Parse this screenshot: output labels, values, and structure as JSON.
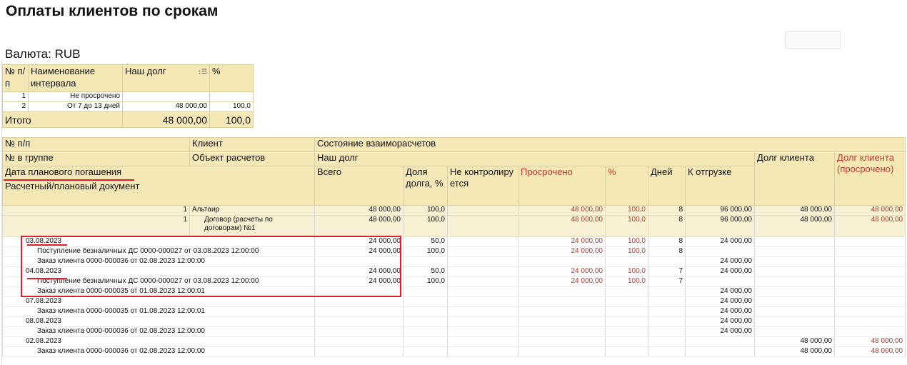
{
  "title": "Оплаты клиентов по срокам",
  "currency_label": "Валюта: RUB",
  "summary": {
    "headers": [
      "№ п/п",
      "Наименование интервала",
      "Наш долг",
      "%"
    ],
    "rows": [
      {
        "num": "1",
        "name": "Не просрочено",
        "debt": "",
        "pct": ""
      },
      {
        "num": "2",
        "name": "От 7 до 13 дней",
        "debt": "48 000,00",
        "pct": "100,0"
      }
    ],
    "total": {
      "label": "Итого",
      "debt": "48 000,00",
      "pct": "100,0"
    }
  },
  "main": {
    "header": {
      "num": "№ п/п",
      "client": "Клиент",
      "state": "Состояние взаиморасчетов",
      "group_num": "№ в группе",
      "object": "Объект расчетов",
      "our_debt": "Наш долг",
      "client_debt": "Долг клиента",
      "client_debt_overdue": "Долг клиента (просрочено)",
      "due_date": "Дата планового погашения",
      "doc": "Расчетный/плановый документ",
      "total": "Всего",
      "share": "Доля долга, %",
      "uncontrolled": "Не контролируется",
      "overdue": "Просрочено",
      "pct": "%",
      "days": "Дней",
      "to_ship": "К отгрузке"
    },
    "groups": [
      {
        "num": "1",
        "name": "Альтаир",
        "total": "48 000,00",
        "share": "100,0",
        "overdue": "48 000,00",
        "pct": "100,0",
        "days": "8",
        "ship": "96 000,00",
        "cdebt": "48 000,00",
        "cover": "48 000,00"
      },
      {
        "num": "1",
        "name": "Договор (расчеты по договорам) №1",
        "total": "48 000,00",
        "share": "100,0",
        "overdue": "48 000,00",
        "pct": "100,0",
        "days": "8",
        "ship": "96 000,00",
        "cdebt": "48 000,00",
        "cover": "48 000,00"
      }
    ],
    "details": [
      {
        "date": "03.08.2023",
        "total": "24 000,00",
        "share": "50,0",
        "overdue": "24 000,00",
        "pct": "100,0",
        "days": "8",
        "ship": "24 000,00",
        "cdebt": "",
        "cover": ""
      },
      {
        "doc": "Поступление безналичных ДС 0000-000027 от 03.08.2023 12:00:00",
        "total": "24 000,00",
        "share": "100,0",
        "overdue": "24 000,00",
        "pct": "100,0",
        "days": "8",
        "ship": "",
        "cdebt": "",
        "cover": ""
      },
      {
        "doc": "Заказ клиента 0000-000036 от 02.08.2023 12:00:00",
        "total": "",
        "share": "",
        "overdue": "",
        "pct": "",
        "days": "",
        "ship": "24 000,00",
        "cdebt": "",
        "cover": ""
      },
      {
        "date": "04.08.2023",
        "total": "24 000,00",
        "share": "50,0",
        "overdue": "24 000,00",
        "pct": "100,0",
        "days": "7",
        "ship": "24 000,00",
        "cdebt": "",
        "cover": ""
      },
      {
        "doc": "Поступление безналичных ДС 0000-000027 от 03.08.2023 12:00:00",
        "total": "24 000,00",
        "share": "100,0",
        "overdue": "24 000,00",
        "pct": "100,0",
        "days": "7",
        "ship": "",
        "cdebt": "",
        "cover": ""
      },
      {
        "doc": "Заказ клиента 0000-000035 от 01.08.2023 12:00:01",
        "total": "",
        "share": "",
        "overdue": "",
        "pct": "",
        "days": "",
        "ship": "24 000,00",
        "cdebt": "",
        "cover": ""
      },
      {
        "date": "07.08.2023",
        "total": "",
        "share": "",
        "overdue": "",
        "pct": "",
        "days": "",
        "ship": "24 000,00",
        "cdebt": "",
        "cover": ""
      },
      {
        "doc": "Заказ клиента 0000-000035 от 01.08.2023 12:00:01",
        "total": "",
        "share": "",
        "overdue": "",
        "pct": "",
        "days": "",
        "ship": "24 000,00",
        "cdebt": "",
        "cover": ""
      },
      {
        "date": "08.08.2023",
        "total": "",
        "share": "",
        "overdue": "",
        "pct": "",
        "days": "",
        "ship": "24 000,00",
        "cdebt": "",
        "cover": ""
      },
      {
        "doc": "Заказ клиента 0000-000036 от 02.08.2023 12:00:00",
        "total": "",
        "share": "",
        "overdue": "",
        "pct": "",
        "days": "",
        "ship": "24 000,00",
        "cdebt": "",
        "cover": ""
      },
      {
        "date": "02.08.2023",
        "total": "",
        "share": "",
        "overdue": "",
        "pct": "",
        "days": "",
        "ship": "",
        "cdebt": "48 000,00",
        "cover": "48 000,00"
      },
      {
        "doc": "Заказ клиента 0000-000036 от 02.08.2023 12:00:00",
        "total": "",
        "share": "",
        "overdue": "",
        "pct": "",
        "days": "",
        "ship": "",
        "cdebt": "48 000,00",
        "cover": "48 000,00"
      }
    ]
  },
  "colors": {
    "header_bg": "#f4e8b6",
    "group_bg": "#f7f0d3",
    "overdue_text": "#c0392b",
    "annotation_red": "#e01e2a"
  }
}
